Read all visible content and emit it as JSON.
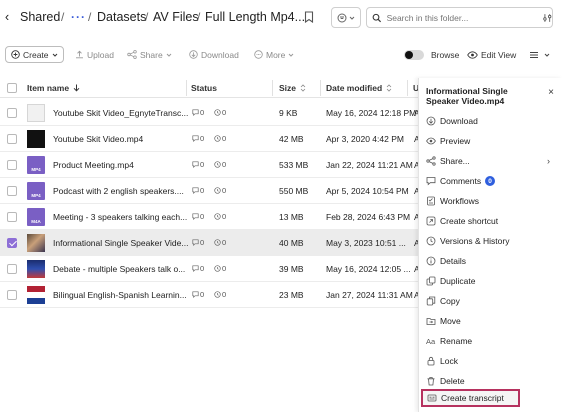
{
  "breadcrumb": {
    "back": "‹",
    "items": [
      "Shared",
      "···",
      "Datasets",
      "AV Files",
      "Full Length Mp4..."
    ],
    "separator": "/"
  },
  "search": {
    "placeholder": "Search in this folder..."
  },
  "toolbar": {
    "create_label": "Create",
    "upload_label": "Upload",
    "share_label": "Share",
    "download_label": "Download",
    "more_label": "More",
    "browse_label": "Browse",
    "edit_view_label": "Edit View"
  },
  "table": {
    "headers": {
      "name": "Item name",
      "status": "Status",
      "size": "Size",
      "date": "Date modified",
      "extra": "U"
    },
    "rows": [
      {
        "name": "Youtube Skit Video_EgnyteTransc...",
        "thumb": "doc",
        "comments": "0",
        "views": "0",
        "size": "9 KB",
        "date": "May 16, 2024 12:18 PM",
        "extra": "A",
        "selected": false
      },
      {
        "name": "Youtube Skit Video.mp4",
        "thumb": "black",
        "comments": "0",
        "views": "0",
        "size": "42 MB",
        "date": "Apr 3, 2020 4:42 PM",
        "extra": "A",
        "selected": false
      },
      {
        "name": "Product Meeting.mp4",
        "thumb": "mp4",
        "comments": "0",
        "views": "0",
        "size": "533 MB",
        "date": "Jan 22, 2024 11:21 AM",
        "extra": "A",
        "selected": false
      },
      {
        "name": "Podcast with 2 english speakers....",
        "thumb": "mp4",
        "comments": "0",
        "views": "0",
        "size": "550 MB",
        "date": "Apr 5, 2024 10:54 PM",
        "extra": "A",
        "selected": false
      },
      {
        "name": "Meeting - 3 speakers talking each...",
        "thumb": "m4a",
        "comments": "0",
        "views": "0",
        "size": "13 MB",
        "date": "Feb 28, 2024 6:43 PM",
        "extra": "A",
        "selected": false
      },
      {
        "name": "Informational Single Speaker Vide...",
        "thumb": "photo",
        "comments": "0",
        "views": "0",
        "size": "40 MB",
        "date": "May 3, 2023 10:51 ...",
        "extra": "A",
        "selected": true
      },
      {
        "name": "Debate - multiple Speakers talk o...",
        "thumb": "news",
        "comments": "0",
        "views": "0",
        "size": "39 MB",
        "date": "May 16, 2024 12:05 ...",
        "extra": "A",
        "selected": false
      },
      {
        "name": "Bilingual English-Spanish Learnin...",
        "thumb": "flag",
        "comments": "0",
        "views": "0",
        "size": "23 MB",
        "date": "Jan 27, 2024 11:31 AM",
        "extra": "A",
        "selected": false
      }
    ]
  },
  "panel": {
    "title": "Informational Single Speaker Video.mp4",
    "close": "×",
    "items": [
      {
        "label": "Download",
        "icon": "download-icon"
      },
      {
        "label": "Preview",
        "icon": "eye-icon"
      },
      {
        "label": "Share...",
        "icon": "share-icon",
        "chevron": "›"
      },
      {
        "label": "Comments",
        "icon": "comment-icon",
        "badge": "0"
      },
      {
        "label": "Workflows",
        "icon": "workflow-icon"
      },
      {
        "label": "Create shortcut",
        "icon": "shortcut-icon"
      },
      {
        "label": "Versions & History",
        "icon": "history-icon"
      },
      {
        "label": "Details",
        "icon": "info-icon"
      },
      {
        "label": "Duplicate",
        "icon": "duplicate-icon"
      },
      {
        "label": "Copy",
        "icon": "copy-icon"
      },
      {
        "label": "Move",
        "icon": "move-icon"
      },
      {
        "label": "Rename",
        "icon": "rename-icon"
      },
      {
        "label": "Lock",
        "icon": "lock-icon"
      },
      {
        "label": "Delete",
        "icon": "trash-icon"
      },
      {
        "label": "Create transcript",
        "icon": "transcript-icon",
        "highlighted": true
      }
    ]
  },
  "colors": {
    "accent": "#3a5bd9",
    "selection": "#8e6fd6",
    "highlight_border": "#b6325f",
    "badge": "#2f5fde"
  },
  "thumb_labels": {
    "mp4": "MP4",
    "m4a": "M4A"
  }
}
